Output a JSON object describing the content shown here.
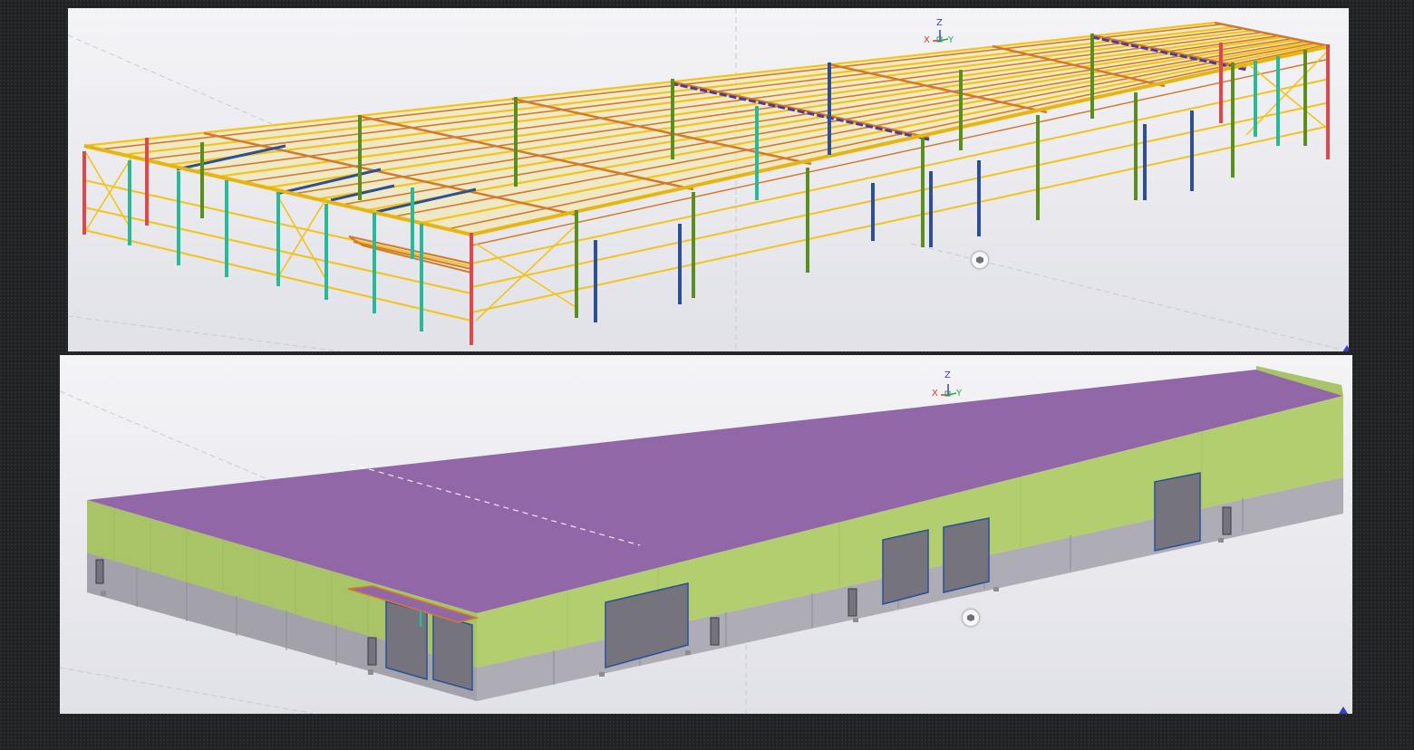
{
  "views": {
    "structure": {
      "axis": {
        "z": "Z",
        "x": "X",
        "y": "Y"
      },
      "icon": "view-cube-icon"
    },
    "cladding": {
      "axis": {
        "z": "Z",
        "x": "X",
        "y": "Y"
      },
      "icon": "view-cube-icon"
    }
  },
  "colors": {
    "roof_cladding": "#9267a8",
    "wall_cladding": "#a8c466",
    "base_wall": "#a3a2ab",
    "door": "#75747c",
    "steel_yellow": "#f2c41b",
    "steel_orange": "#d27a2b",
    "column_green": "#5a8e1f",
    "column_teal": "#28b89a",
    "column_blue": "#2b4f99",
    "column_red": "#e0474a",
    "axis_z": "#3a3dc8",
    "axis_x": "#d23a3a",
    "axis_y": "#2aa44a"
  }
}
